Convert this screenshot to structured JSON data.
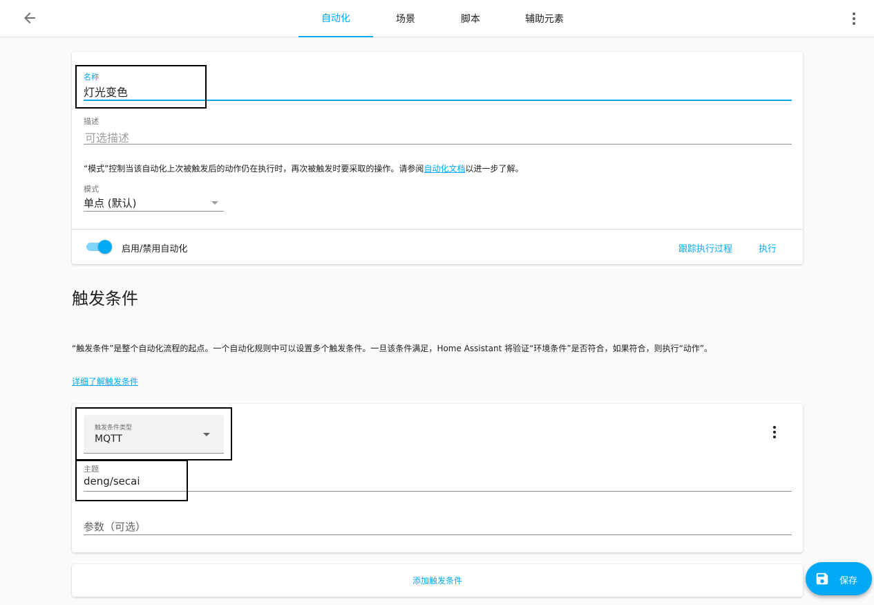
{
  "header": {
    "tabs": [
      {
        "label": "自动化",
        "active": true
      },
      {
        "label": "场景"
      },
      {
        "label": "脚本"
      },
      {
        "label": "辅助元素"
      }
    ]
  },
  "settings": {
    "name_label": "名称",
    "name_value": "灯光变色",
    "desc_label": "描述",
    "desc_placeholder": "可选描述",
    "mode_text_pre": "“模式”控制当该自动化上次被触发后的动作仍在执行时，再次被触发时要采取的操作。请参阅",
    "mode_link": "自动化文档",
    "mode_text_post": "以进一步了解。",
    "mode_label": "模式",
    "mode_value": "单点 (默认)",
    "toggle_label": "启用/禁用自动化",
    "toggle_on": true,
    "trace_button": "跟踪执行过程",
    "run_button": "执行"
  },
  "triggers": {
    "heading": "触发条件",
    "description": "“触发条件”是整个自动化流程的起点。一个自动化规则中可以设置多个触发条件。一旦该条件满足，Home Assistant 将验证“环境条件”是否符合，如果符合，则执行“动作”。",
    "learn_more": "详细了解触发条件",
    "trigger_type_label": "触发条件类型",
    "trigger_type_value": "MQTT",
    "topic_label": "主题",
    "topic_value": "deng/secai",
    "payload_placeholder": "参数（可选）",
    "add_button": "添加触发条件"
  },
  "fab": {
    "save_label": "保存"
  },
  "colors": {
    "accent": "#03a9f4"
  }
}
